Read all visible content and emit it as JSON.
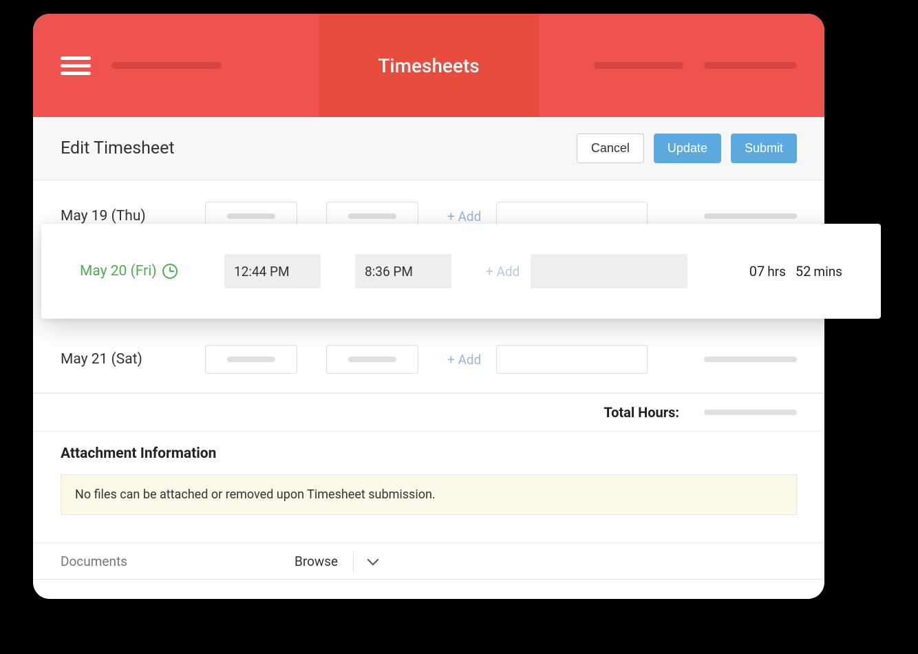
{
  "header": {
    "title": "Timesheets"
  },
  "subheader": {
    "title": "Edit Timesheet",
    "cancel": "Cancel",
    "update": "Update",
    "submit": "Submit"
  },
  "rows": {
    "day1": {
      "label": "May 19 (Thu)",
      "add": "+ Add"
    },
    "featured": {
      "label": "May 20 (Fri)",
      "start": "12:44 PM",
      "end": "8:36 PM",
      "add": "+ Add",
      "hours_num": "07",
      "hours_unit": "hrs",
      "mins_num": "52",
      "mins_unit": "mins"
    },
    "day3": {
      "label": "May 21 (Sat)",
      "add": "+ Add"
    }
  },
  "totals": {
    "label": "Total Hours:"
  },
  "attachment": {
    "title": "Attachment Information",
    "warning": "No files can be attached or removed upon Timesheet submission."
  },
  "documents": {
    "label": "Documents",
    "browse": "Browse"
  }
}
